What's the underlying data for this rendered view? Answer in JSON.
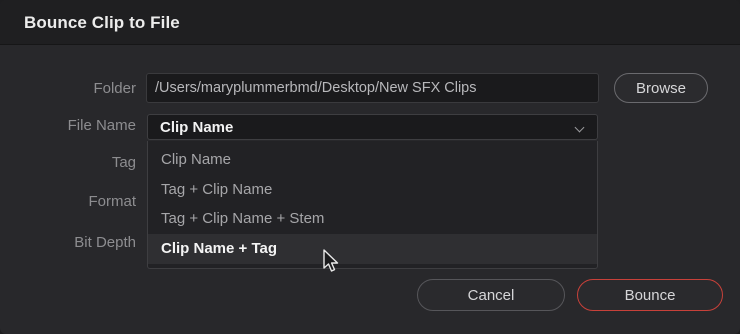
{
  "dialog": {
    "title": "Bounce Clip to File"
  },
  "form": {
    "folder_label": "Folder",
    "folder_value": "/Users/maryplummerbmd/Desktop/New SFX Clips",
    "browse_label": "Browse",
    "file_name_label": "File Name",
    "file_name_selected": "Clip Name",
    "tag_label": "Tag",
    "format_label": "Format",
    "bit_depth_label": "Bit Depth"
  },
  "dropdown": {
    "options": [
      "Clip Name",
      "Tag + Clip Name",
      "Tag + Clip Name + Stem",
      "Clip Name + Tag"
    ],
    "highlighted_index": 3
  },
  "buttons": {
    "cancel_label": "Cancel",
    "bounce_label": "Bounce"
  },
  "colors": {
    "accent_bounce_border": "#c8413a",
    "dialog_background": "#28282b"
  },
  "icons": {
    "dropdown": "chevron-down-icon",
    "pointer": "mouse-pointer-icon"
  }
}
